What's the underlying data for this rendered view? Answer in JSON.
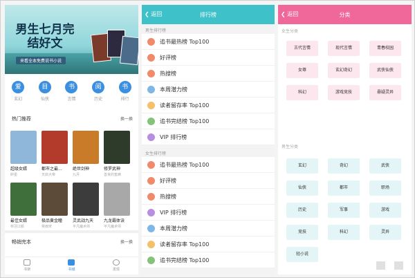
{
  "screen1": {
    "banner": {
      "title": "男生七月完结好文",
      "subtitle": "来看全本免费说书小说"
    },
    "shortcuts": [
      {
        "glyph": "爱",
        "label": "玄幻",
        "color": "#3b8fe0"
      },
      {
        "glyph": "目",
        "label": "仙侠",
        "color": "#3b8fe0"
      },
      {
        "glyph": "书",
        "label": "言情",
        "color": "#3b8fe0"
      },
      {
        "glyph": "阅",
        "label": "历史",
        "color": "#3b8fe0"
      },
      {
        "glyph": "书",
        "label": "排行",
        "color": "#3b8fe0"
      }
    ],
    "hot": {
      "title": "热门推荐",
      "more": "换一换"
    },
    "books": [
      {
        "title": "超级女婿",
        "author": "醉墨",
        "color": "#8fb7d9"
      },
      {
        "title": "都市之最...",
        "author": "天启大帝",
        "color": "#b33b2b"
      },
      {
        "title": "绝世剑神",
        "author": "九月",
        "color": "#c97b2a"
      },
      {
        "title": "修罗武神",
        "author": "善良的蜜蜂",
        "color": "#2f3b2a"
      },
      {
        "title": "最佳女婿",
        "author": "林羽江颜",
        "color": "#3f6f3a"
      },
      {
        "title": "极品黄金瞳",
        "author": "吴雨宋",
        "color": "#5d4b3a"
      },
      {
        "title": "灵武战九天",
        "author": "平凡魔术师",
        "color": "#3c3c3c"
      },
      {
        "title": "九龙霸体诀",
        "author": "平凡魔术师",
        "color": "#a8a8a8"
      }
    ],
    "sale": {
      "title": "畅销完本",
      "more": "换一换"
    },
    "tabs": [
      {
        "label": "书架"
      },
      {
        "label": "书城"
      },
      {
        "label": "发现"
      }
    ]
  },
  "screen2": {
    "back": "返回",
    "title": "排行榜",
    "accent": "#3fc1c9",
    "male_header": "男生排行榜",
    "female_header": "女生排行榜",
    "male": [
      {
        "label": "追书最热榜 Top100",
        "color": "#f08a6a"
      },
      {
        "label": "好评榜",
        "color": "#f08a6a"
      },
      {
        "label": "热搜榜",
        "color": "#f08a6a"
      },
      {
        "label": "本周潜力榜",
        "color": "#7fb6e6"
      },
      {
        "label": "读者留存率 Top100",
        "color": "#f4c06a"
      },
      {
        "label": "追书完结榜 Top100",
        "color": "#86c27a"
      },
      {
        "label": "VIP 排行榜",
        "color": "#b88ee0"
      }
    ],
    "female": [
      {
        "label": "追书最热榜 Top100",
        "color": "#f08a6a"
      },
      {
        "label": "好评榜",
        "color": "#f08a6a"
      },
      {
        "label": "热搜榜",
        "color": "#f08a6a"
      },
      {
        "label": "VIP 排行榜",
        "color": "#b88ee0"
      },
      {
        "label": "本周潜力榜",
        "color": "#7fb6e6"
      },
      {
        "label": "读者留存率 Top100",
        "color": "#f4c06a"
      },
      {
        "label": "追书完结榜 Top100",
        "color": "#86c27a"
      }
    ]
  },
  "screen3": {
    "back": "返回",
    "title": "分类",
    "accent": "#f0679a",
    "female_header": "女生分类",
    "male_header": "男生分类",
    "female": [
      "古代言情",
      "现代言情",
      "青春校园",
      "女尊",
      "玄幻奇幻",
      "武侠仙侠",
      "科幻",
      "游戏竞技",
      "悬疑灵异"
    ],
    "male": [
      "玄幻",
      "奇幻",
      "武侠",
      "仙侠",
      "都市",
      "职场",
      "历史",
      "军事",
      "游戏",
      "竞技",
      "科幻",
      "灵异",
      "轻小说"
    ]
  }
}
